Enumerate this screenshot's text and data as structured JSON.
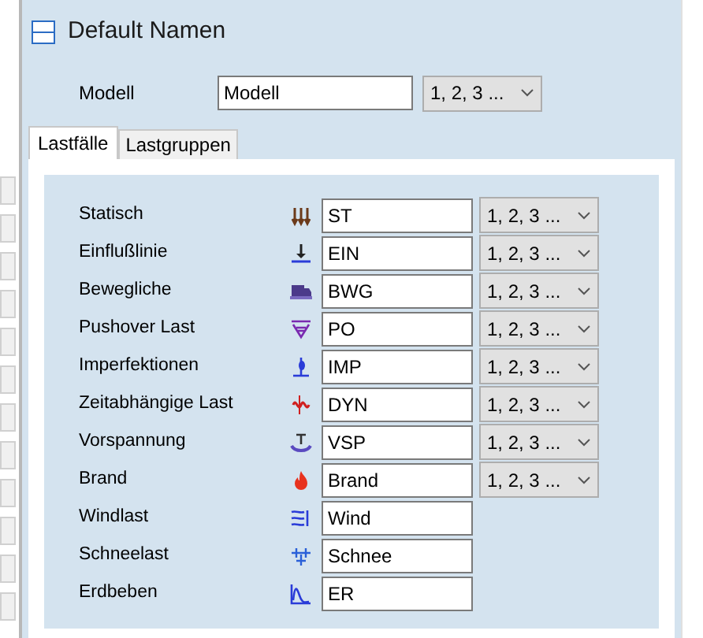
{
  "panel": {
    "title": "Default Namen",
    "expanded": true
  },
  "model": {
    "label": "Modell",
    "value": "Modell",
    "numbering": "1, 2, 3 ..."
  },
  "tabs": [
    {
      "label": "Lastfälle",
      "selected": true
    },
    {
      "label": "Lastgruppen",
      "selected": false
    }
  ],
  "rows": [
    {
      "label": "Statisch",
      "value": "ST",
      "numbering": "1, 2, 3 ..."
    },
    {
      "label": "Einflußlinie",
      "value": "EIN",
      "numbering": "1, 2, 3 ..."
    },
    {
      "label": "Bewegliche",
      "value": "BWG",
      "numbering": "1, 2, 3 ..."
    },
    {
      "label": "Pushover Last",
      "value": "PO",
      "numbering": "1, 2, 3 ..."
    },
    {
      "label": "Imperfektionen",
      "value": "IMP",
      "numbering": "1, 2, 3 ..."
    },
    {
      "label": "Zeitabhängige Last",
      "value": "DYN",
      "numbering": "1, 2, 3 ..."
    },
    {
      "label": "Vorspannung",
      "value": "VSP",
      "numbering": "1, 2, 3 ..."
    },
    {
      "label": "Brand",
      "value": "Brand",
      "numbering": "1, 2, 3 ..."
    },
    {
      "label": "Windlast",
      "value": "Wind"
    },
    {
      "label": "Schneelast",
      "value": "Schnee"
    },
    {
      "label": "Erdbeben",
      "value": "ER"
    }
  ]
}
